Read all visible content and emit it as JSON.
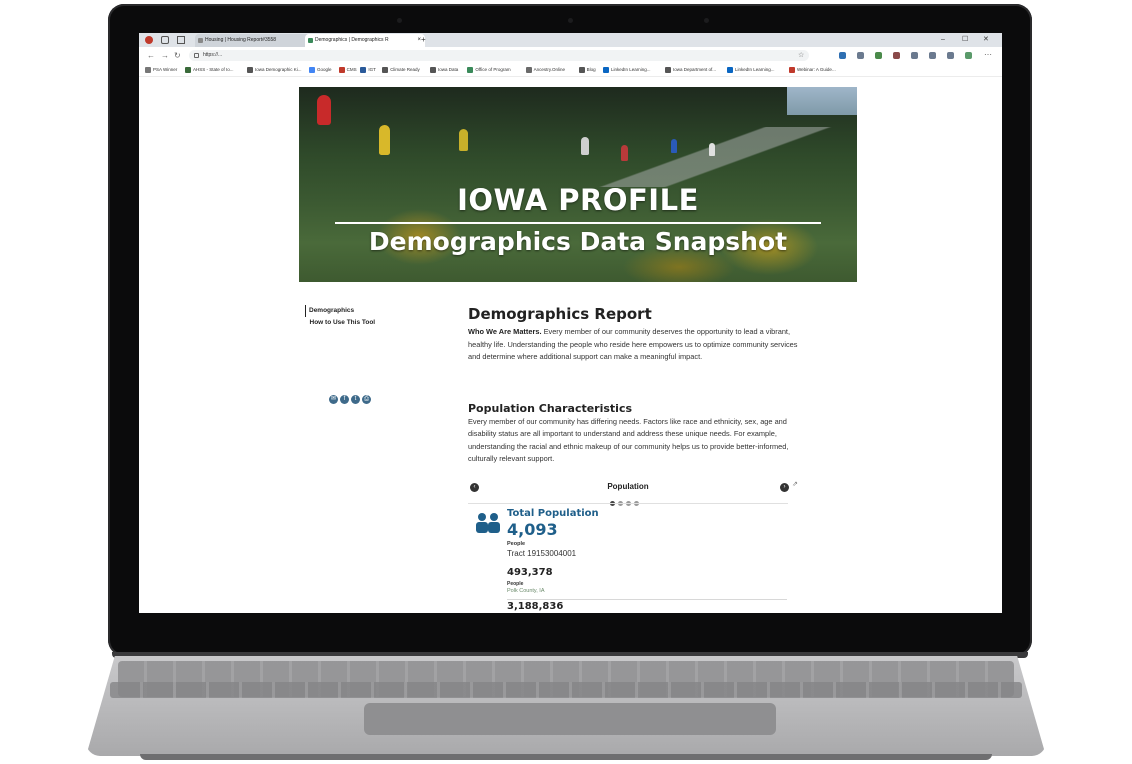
{
  "browser": {
    "tabs": [
      {
        "label": "Housing | Housing Report#3558"
      },
      {
        "label": "Demographics | Demographics R"
      }
    ],
    "url": "https://...",
    "bookmarks": [
      "PSA Winner",
      "AHSS - State of Io...",
      "Iowa Demographic Ki...",
      "Google",
      "CMS",
      "IGT",
      "Climate Ready",
      "Iowa Data",
      "Office of Program",
      "Ancestry.Online",
      "Blog",
      "LinkedIn Learning...",
      "Iowa Department of...",
      "LinkedIn Learning...",
      "Webinar: A Guide..."
    ]
  },
  "hero": {
    "title": "IOWA PROFILE",
    "subtitle": "Demographics Data Snapshot"
  },
  "sidebar": {
    "items": [
      {
        "label": "Demographics"
      },
      {
        "label": "How to Use This Tool"
      }
    ]
  },
  "report": {
    "title": "Demographics Report",
    "intro_bold": "Who We Are Matters.",
    "intro_text": " Every member of our community deserves the opportunity to lead a vibrant, healthy life. Understanding the people who reside here empowers us to optimize community services and determine where additional support can make a meaningful impact.",
    "section_title": "Population Characteristics",
    "section_text": "Every member of our community has differing needs. Factors like race and ethnicity, sex, age and disability status are all important to understand and address these unique needs. For example, understanding the racial and ethnic makeup of our community helps us to provide better-informed, culturally relevant support."
  },
  "population_card": {
    "title": "Population",
    "dots": 4,
    "active_dot": 0,
    "metric_label": "Total Population",
    "metric_value": "4,093",
    "metric_unit": "People",
    "tract": "Tract 19153004001",
    "comparison_value": "493,378",
    "comparison_unit": "People",
    "comparison_area": "Polk County, IA",
    "comparison2_value": "3,188,836"
  },
  "colors": {
    "accent": "#1f5f8a",
    "share_icon_bg": "#3e6a8a"
  },
  "icons": {
    "share": [
      "email-icon",
      "facebook-icon",
      "twitter-icon",
      "print-icon"
    ],
    "prev": "chevron-left-icon",
    "next": "chevron-right-icon",
    "pin": "link-icon",
    "people": "people-icon"
  }
}
